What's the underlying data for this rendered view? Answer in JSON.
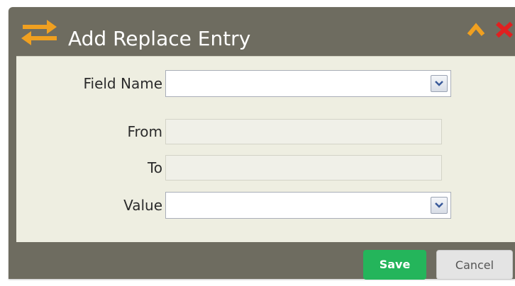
{
  "dialog": {
    "title": "Add Replace Entry",
    "title_icon": "swap-arrows-icon",
    "collapse_icon": "chevron-up-icon",
    "close_icon": "close-x-icon"
  },
  "form": {
    "field_name": {
      "label": "Field Name",
      "value": ""
    },
    "from": {
      "label": "From",
      "value": ""
    },
    "to": {
      "label": "To",
      "value": ""
    },
    "value": {
      "label": "Value",
      "value": ""
    }
  },
  "actions": {
    "save_label": "Save",
    "cancel_label": "Cancel"
  },
  "colors": {
    "accent_orange": "#f0a020",
    "close_red": "#e02020",
    "save_green": "#24b55b"
  }
}
